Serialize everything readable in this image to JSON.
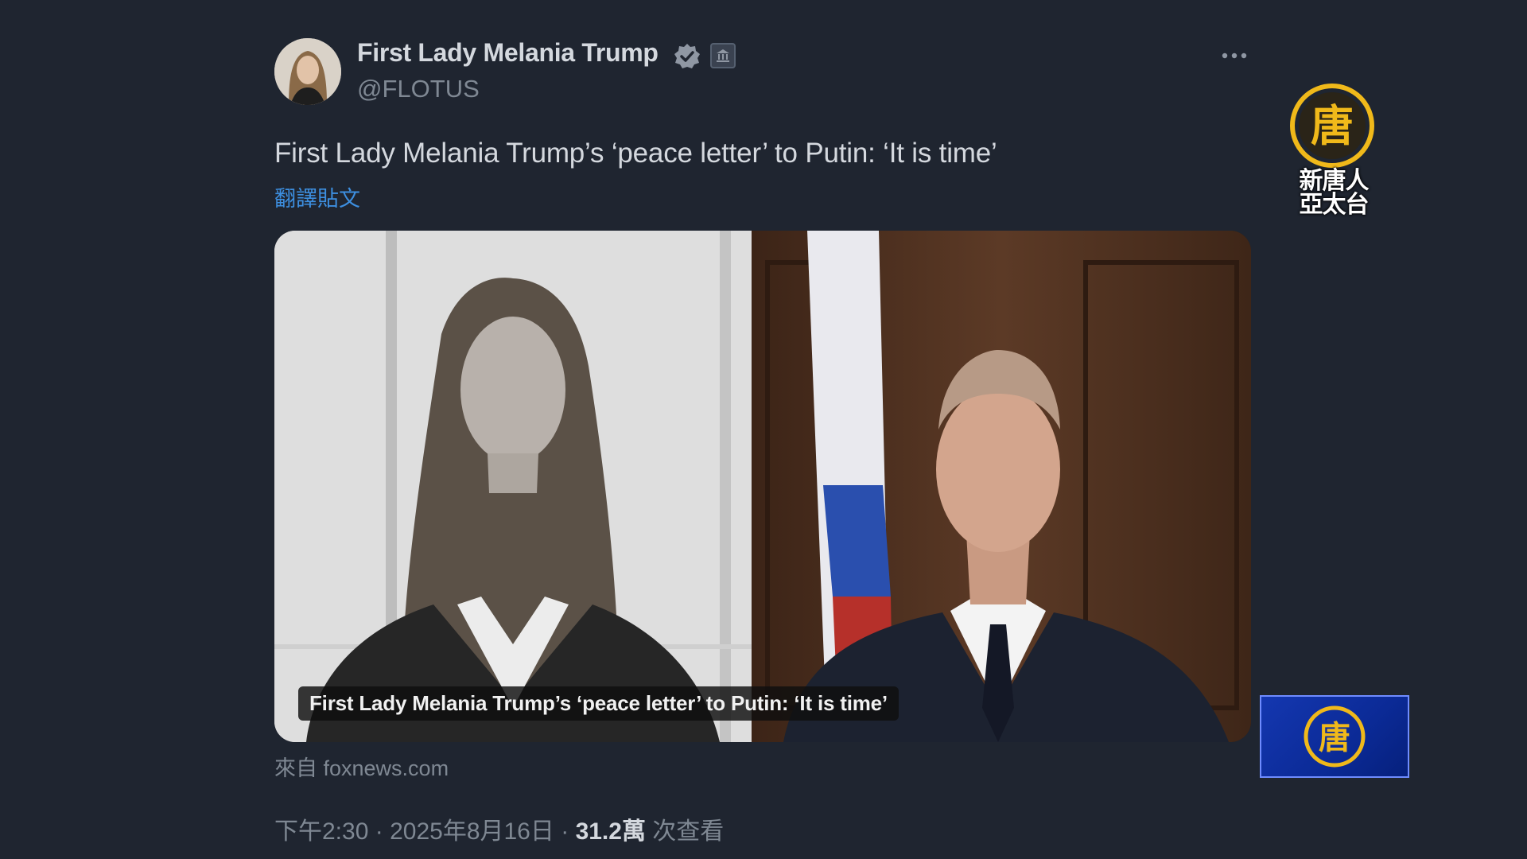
{
  "tweet": {
    "display_name": "First Lady Melania Trump",
    "handle": "@FLOTUS",
    "text": "First Lady Melania Trump’s ‘peace letter’ to Putin: ‘It is time’",
    "translate_label": "翻譯貼文",
    "media": {
      "caption": "First Lady Melania Trump’s ‘peace letter’ to Putin: ‘It is time’"
    },
    "source": "來自 foxnews.com",
    "time": "下午2:30",
    "date": "2025年8月16日",
    "separator": "·",
    "views_count": "31.2萬",
    "views_label": "次查看"
  },
  "icons": {
    "verified": "verified-badge-icon",
    "affiliate": "government-affiliate-icon",
    "more": "more-options-icon"
  },
  "overlay": {
    "channel_name_line1": "新唐人",
    "channel_name_line2": "亞太台",
    "logo_glyph": "唐"
  },
  "colors": {
    "background": "#1f2530",
    "primary_text": "#d4d8de",
    "secondary_text": "#7f8893",
    "link": "#3d8fe0",
    "logo_gold": "#f0b91a",
    "bug_blue": "#0b2a96"
  }
}
